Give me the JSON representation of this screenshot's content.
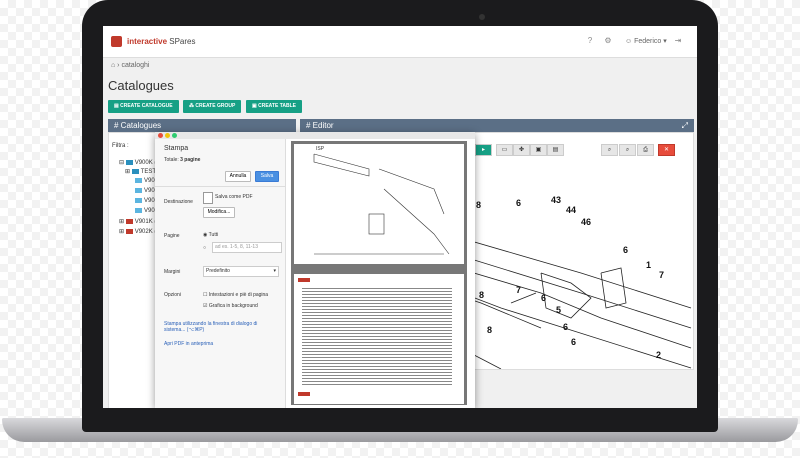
{
  "app": {
    "logo_red": "interactive ",
    "logo_rest": "SPares",
    "user": "Federico"
  },
  "breadcrumb": {
    "current": "cataloghi"
  },
  "page_title": "Catalogues",
  "actions": {
    "create_catalogue": "CREATE CATALOGUE",
    "create_group": "CREATE GROUP",
    "create_table": "CREATE TABLE"
  },
  "catalogues_panel": {
    "title": "Catalogues",
    "filter_label": "Filtra :",
    "tree": [
      "V900K (",
      "TEST",
      "V90",
      "V90",
      "V90",
      "V90",
      "V901K (",
      "V902K ("
    ]
  },
  "editor_panel": {
    "title": "Editor",
    "part_numbers": [
      "8",
      "6",
      "43",
      "44",
      "46",
      "6",
      "1",
      "7",
      "8",
      "7",
      "6",
      "5",
      "6",
      "8",
      "6",
      "2"
    ]
  },
  "print_dialog": {
    "title": "Stampa",
    "total_label": "Totale:",
    "total_value": "3 pagine",
    "cancel": "Annulla",
    "save": "Salva",
    "destination_label": "Destinazione",
    "destination_value": "Salva come PDF",
    "change": "Modifica...",
    "pages_label": "Pagine",
    "pages_all": "Tutti",
    "pages_placeholder": "ad es. 1-5, 8, 11-13",
    "margins_label": "Margini",
    "margins_value": "Predefinito",
    "options_label": "Opzioni",
    "opt_headers": "Intestazioni e piè di pagina",
    "opt_background": "Grafica in background",
    "system_dialog_link": "Stampa utilizzando la finestra di dialogo di sistema... (⌥⌘P)",
    "open_pdf_link": "Apri PDF in anteprima"
  },
  "preview": {
    "sheet_label": "ISP"
  },
  "colors": {
    "teal": "#16a085",
    "panel_header": "#5b6f86",
    "brand_red": "#c0392b"
  }
}
